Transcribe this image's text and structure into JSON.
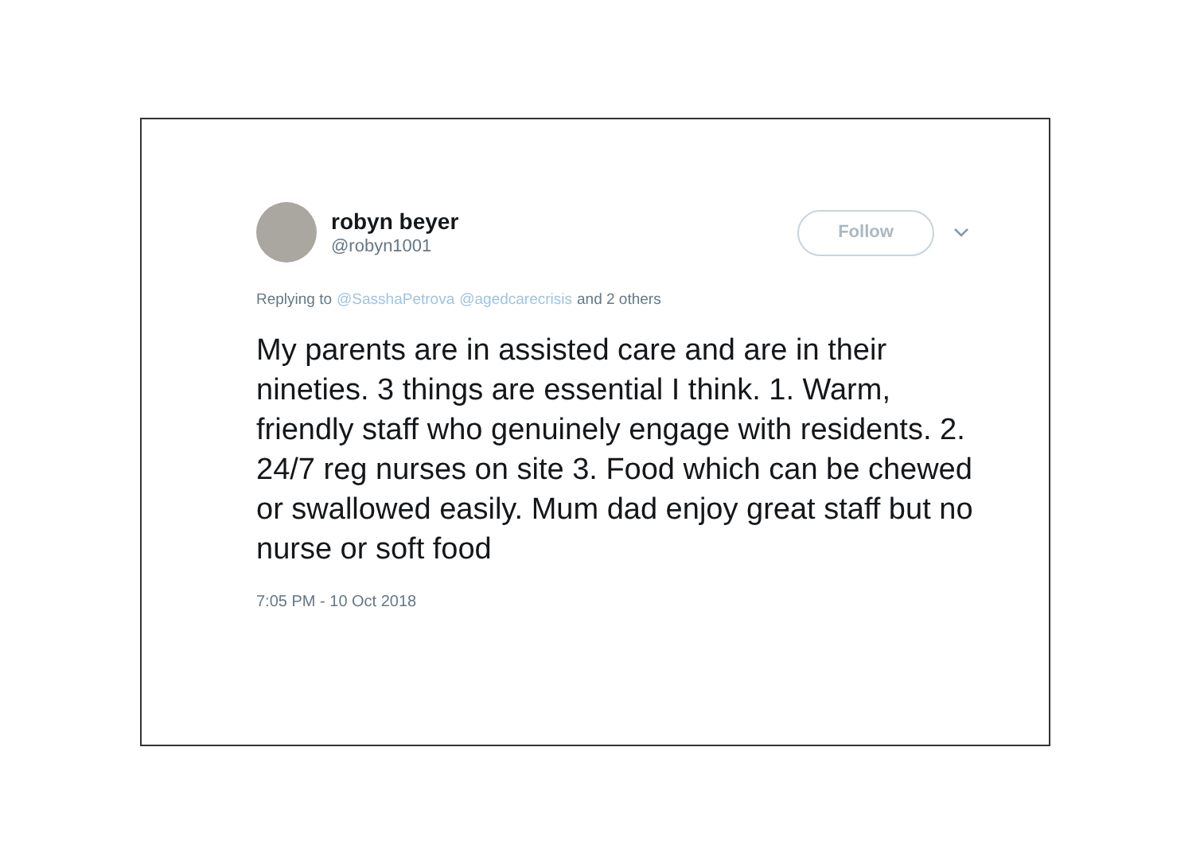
{
  "tweet": {
    "author": {
      "name": "robyn beyer",
      "handle": "@robyn1001"
    },
    "follow_button": "Follow",
    "replying": {
      "prefix": "Replying to",
      "mentions": [
        "@SasshaPetrova",
        "@agedcarecrisis"
      ],
      "suffix": "and 2 others"
    },
    "text": "My parents are in assisted care and are in their nineties. 3 things are essential I think. 1. Warm, friendly staff who genuinely engage with residents. 2. 24/7 reg nurses on site 3. Food which can be chewed or swallowed easily. Mum dad enjoy great staff but no nurse or soft food",
    "timestamp": "7:05 PM - 10 Oct 2018"
  }
}
